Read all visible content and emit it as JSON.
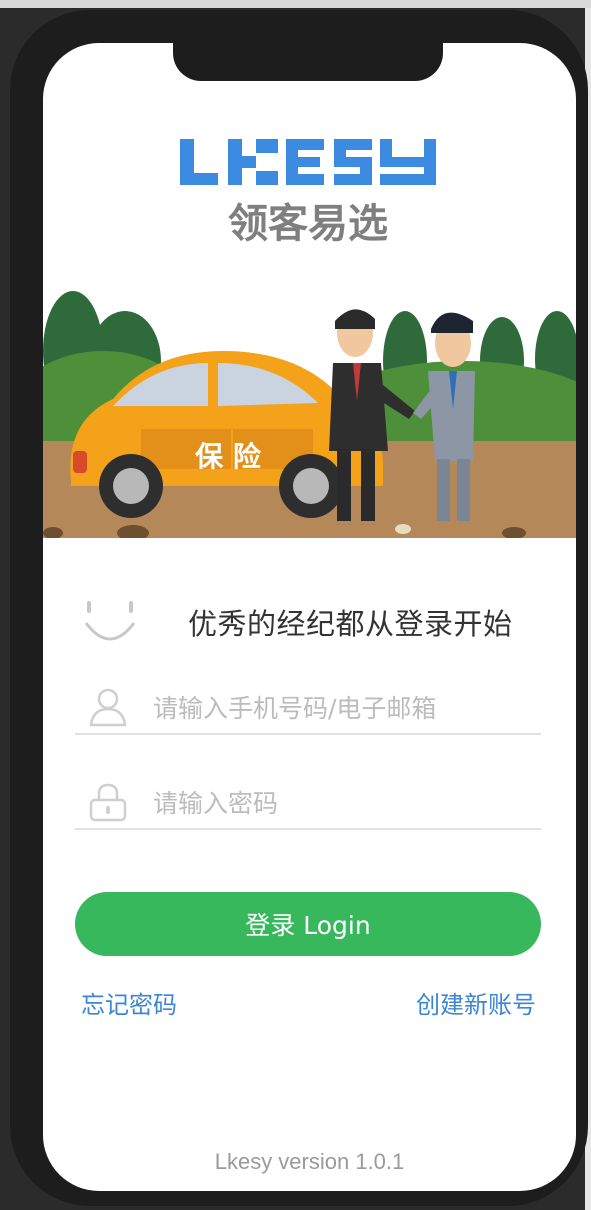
{
  "app": {
    "logo_text": "LKESY",
    "logo_subtitle": "领客易选"
  },
  "illustration": {
    "car_sign": "保 险"
  },
  "login": {
    "slogan": "优秀的经纪都从登录开始",
    "username_placeholder": "请输入手机号码/电子邮箱",
    "password_placeholder": "请输入密码",
    "submit_label": "登录 Login",
    "forgot_label": "忘记密码",
    "register_label": "创建新账号"
  },
  "footer": {
    "version": "Lkesy version 1.0.1"
  },
  "colors": {
    "primary": "#37b85c",
    "link": "#3d86d6",
    "logo_blue": "#3d8be0",
    "logo_gray": "#7f7f7f"
  },
  "icons": {
    "smile": "smile-icon",
    "user": "user-icon",
    "lock": "lock-icon"
  }
}
